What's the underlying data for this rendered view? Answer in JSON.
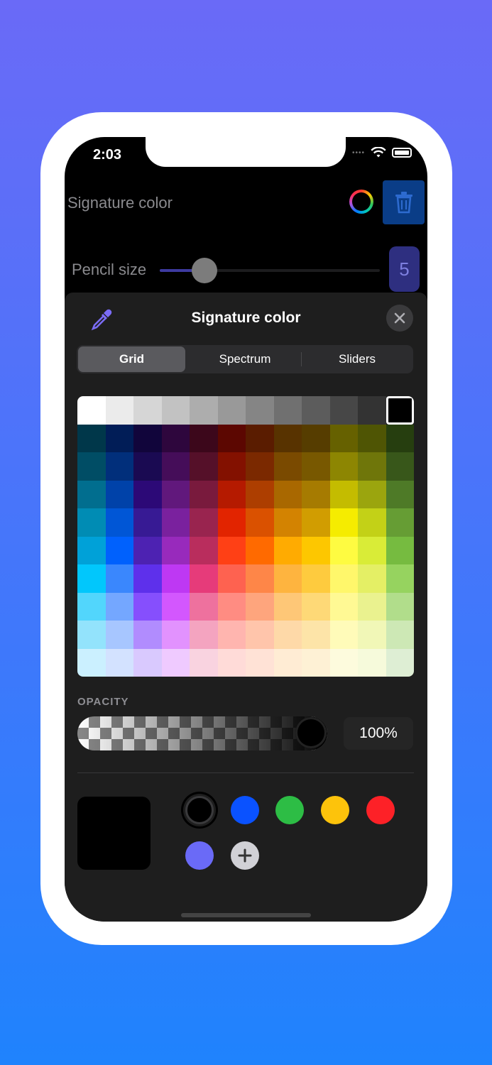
{
  "status_bar": {
    "time": "2:03"
  },
  "header": {
    "signature_label": "Signature color",
    "pencil_label": "Pencil size",
    "pencil_size": "5",
    "pencil_slider_fraction": 0.2
  },
  "sheet": {
    "title": "Signature color",
    "tabs": [
      {
        "label": "Grid",
        "active": true
      },
      {
        "label": "Spectrum",
        "active": false
      },
      {
        "label": "Sliders",
        "active": false
      }
    ],
    "opacity_label": "OPACITY",
    "opacity_value": "100%",
    "selected_color": "#000000",
    "preset_colors": [
      "#000000",
      "#0a52ff",
      "#2dbd45",
      "#fdc30b",
      "#fd2127",
      "#6a6af7"
    ]
  },
  "grid_colors": [
    [
      "#ffffff",
      "#ebebeb",
      "#d6d6d6",
      "#c2c2c2",
      "#adadad",
      "#999999",
      "#858585",
      "#707070",
      "#5c5c5c",
      "#474747",
      "#333333",
      "#000000"
    ],
    [
      "#00374a",
      "#011d57",
      "#11053b",
      "#2e063d",
      "#3c071b",
      "#5c0701",
      "#5a1c00",
      "#583300",
      "#563d00",
      "#666100",
      "#4f5504",
      "#263e0f"
    ],
    [
      "#004d65",
      "#012f7b",
      "#1a0a52",
      "#450d59",
      "#551029",
      "#831100",
      "#7b2900",
      "#7a4a00",
      "#785800",
      "#8d8602",
      "#6f760a",
      "#38571a"
    ],
    [
      "#016e8f",
      "#0042a9",
      "#2c0977",
      "#61187c",
      "#791a3d",
      "#b51a00",
      "#ad3e00",
      "#a96800",
      "#a67b01",
      "#c4bc00",
      "#9ba50e",
      "#4e7a27"
    ],
    [
      "#008cb4",
      "#0056d6",
      "#371a94",
      "#7a219e",
      "#99244f",
      "#e22400",
      "#da5100",
      "#d38301",
      "#d19d01",
      "#f5ec00",
      "#c3d117",
      "#669d34"
    ],
    [
      "#00a1d8",
      "#0061fd",
      "#4d22b2",
      "#982abc",
      "#b92d5d",
      "#ff4015",
      "#ff6a00",
      "#ffab01",
      "#fdc700",
      "#fefb41",
      "#d9ec37",
      "#76bb40"
    ],
    [
      "#01c7fc",
      "#3a87fd",
      "#5e30eb",
      "#be38f3",
      "#e63b7a",
      "#fe6250",
      "#fe8648",
      "#feb43f",
      "#fecb3e",
      "#fff76b",
      "#e4ef65",
      "#96d35f"
    ],
    [
      "#52d6fc",
      "#74a7ff",
      "#864ffd",
      "#d357fe",
      "#ee719e",
      "#ff8c82",
      "#fea57d",
      "#fec777",
      "#fed977",
      "#fff994",
      "#eaf28f",
      "#b1dd8b"
    ],
    [
      "#93e3fc",
      "#a7c6ff",
      "#b18cfe",
      "#e292fe",
      "#f4a4c0",
      "#ffb5af",
      "#ffc5ab",
      "#fed9a8",
      "#fde4a8",
      "#fffbb9",
      "#f1f7b7",
      "#cde8b5"
    ],
    [
      "#cbf0ff",
      "#d3e2ff",
      "#d9c9fe",
      "#efcaff",
      "#f9d3e0",
      "#ffdbd8",
      "#ffe2d6",
      "#ffecd4",
      "#fef1d5",
      "#fdfbdd",
      "#f6fadb",
      "#deeed4"
    ]
  ]
}
